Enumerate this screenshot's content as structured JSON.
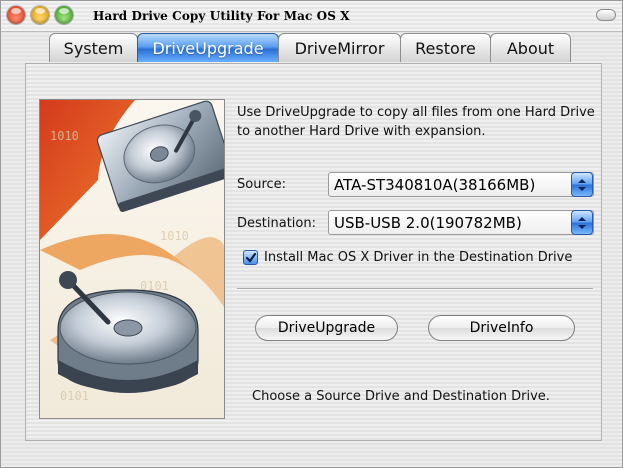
{
  "window": {
    "title": "Hard Drive Copy Utility For Mac OS X"
  },
  "tabs": [
    {
      "label": "System"
    },
    {
      "label": "DriveUpgrade"
    },
    {
      "label": "DriveMirror"
    },
    {
      "label": "Restore"
    },
    {
      "label": "About"
    }
  ],
  "active_tab": "DriveUpgrade",
  "description": "Use DriveUpgrade to copy all files from one Hard Drive to another Hard Drive with expansion.",
  "source": {
    "label": "Source:",
    "value": "ATA-ST340810A(38166MB)"
  },
  "destination": {
    "label": "Destination:",
    "value": "USB-USB 2.0(190782MB)"
  },
  "install_driver": {
    "label": "Install Mac OS X Driver in the Destination Drive",
    "checked": true
  },
  "buttons": {
    "upgrade": "DriveUpgrade",
    "info": "DriveInfo"
  },
  "status": "Choose a Source Drive and Destination Drive.",
  "colors": {
    "accent": "#3a7fe0",
    "art_red": "#c8341c",
    "art_orange": "#e8923a"
  },
  "icons": {
    "close": "close-icon",
    "minimize": "minimize-icon",
    "zoom": "zoom-icon",
    "popup_arrow": "chevron-updown-icon",
    "check": "checkmark-icon",
    "illustration": "hard-drive-illustration-icon"
  }
}
